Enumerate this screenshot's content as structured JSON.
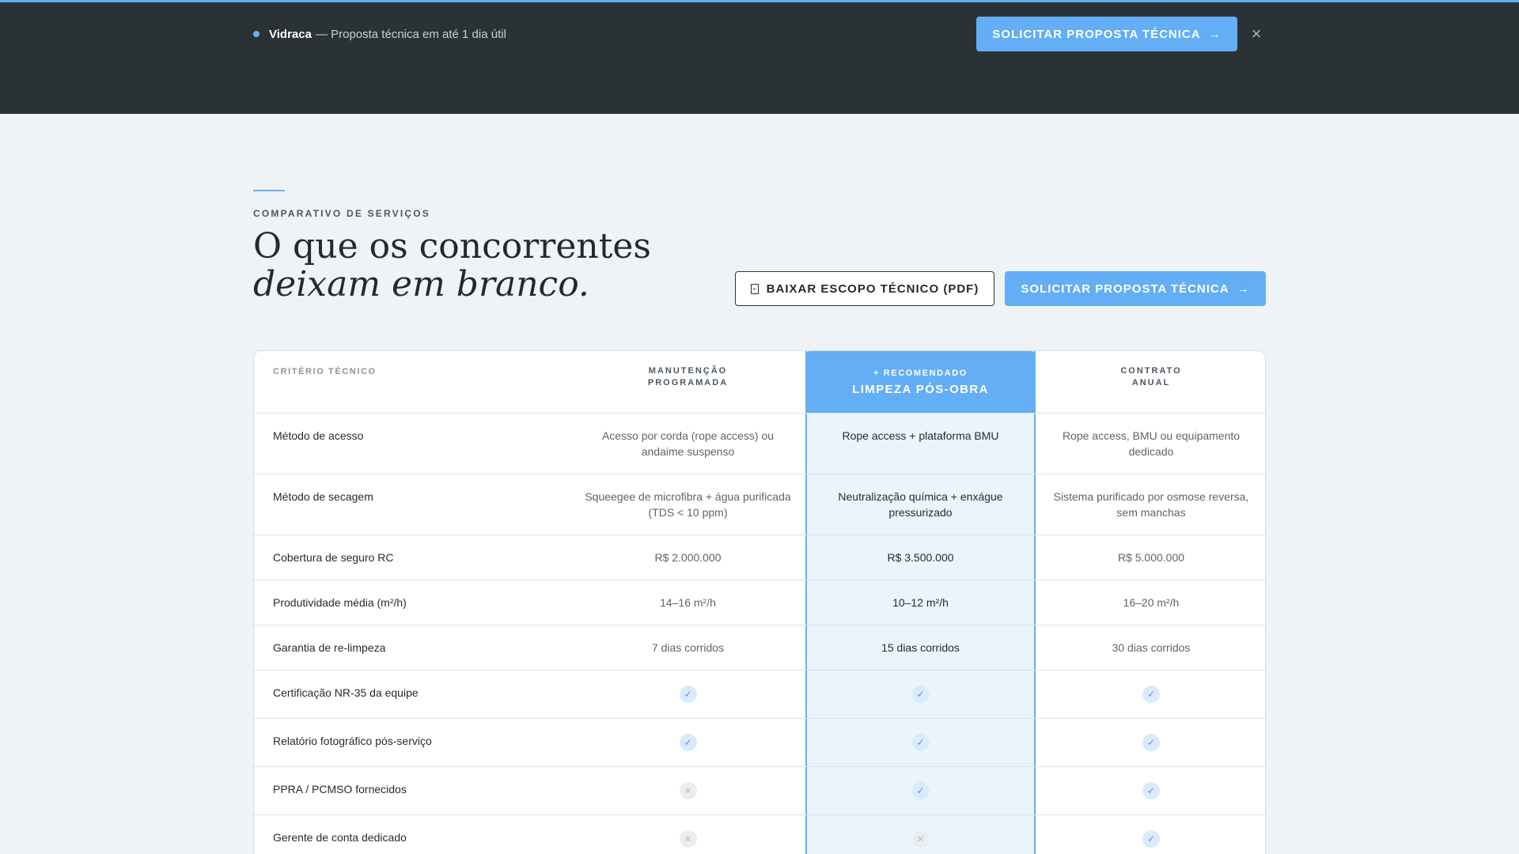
{
  "banner": {
    "brand": "Vidraca",
    "tagline": "— Proposta técnica em até 1 dia útil",
    "cta_label": "SOLICITAR PROPOSTA TÉCNICA",
    "cta_arrow": "→",
    "close_glyph": "×",
    "accent": "#63aef5",
    "background": "#2a3236"
  },
  "section": {
    "eyebrow": "COMPARATIVO DE SERVIÇOS",
    "title_line1": "O que os concorrentes",
    "title_line2": "deixam em branco.",
    "download_label": "BAIXAR ESCOPO TÉCNICO (PDF)",
    "request_label": "SOLICITAR PROPOSTA TÉCNICA",
    "request_arrow": "→"
  },
  "table": {
    "criterion_header": "CRITÉRIO TÉCNICO",
    "col_a_line1": "MANUTENÇÃO",
    "col_a_line2": "PROGRAMADA",
    "col_b_tag": "+ RECOMENDADO",
    "col_b_name": "LIMPEZA PÓS-OBRA",
    "col_c_line1": "CONTRATO",
    "col_c_line2": "ANUAL",
    "rows": [
      {
        "label": "Método de acesso",
        "a": "Acesso por corda (rope access) ou andaime suspenso",
        "b": "Rope access + plataforma BMU",
        "c": "Rope access, BMU ou equipamento dedicado"
      },
      {
        "label": "Método de secagem",
        "a": "Squeegee de microfibra + água purificada (TDS < 10 ppm)",
        "b": "Neutralização química + enxágue pressurizado",
        "c": "Sistema purificado por osmose reversa, sem manchas"
      },
      {
        "label": "Cobertura de seguro RC",
        "a": "R$ 2.000.000",
        "b": "R$ 3.500.000",
        "c": "R$ 5.000.000"
      },
      {
        "label": "Produtividade média (m²/h)",
        "a": "14–16 m²/h",
        "b": "10–12 m²/h",
        "c": "16–20 m²/h"
      },
      {
        "label": "Garantia de re-limpeza",
        "a": "7 dias corridos",
        "b": "15 dias corridos",
        "c": "30 dias corridos"
      }
    ],
    "feature_rows": [
      {
        "label": "Certificação NR-35 da equipe",
        "a": "check-icon",
        "b": "check-icon",
        "c": "check-icon"
      },
      {
        "label": "Relatório fotográfico pós-serviço",
        "a": "check-icon",
        "b": "check-icon",
        "c": "check-icon"
      },
      {
        "label": "PPRA / PCMSO fornecidos",
        "a": "cross-icon",
        "b": "check-icon",
        "c": "check-icon"
      },
      {
        "label": "Gerente de conta dedicado",
        "a": "cross-icon",
        "b": "cross-icon",
        "c": "check-icon"
      }
    ],
    "glyphs": {
      "check-icon": "✓",
      "cross-icon": "✕"
    }
  }
}
